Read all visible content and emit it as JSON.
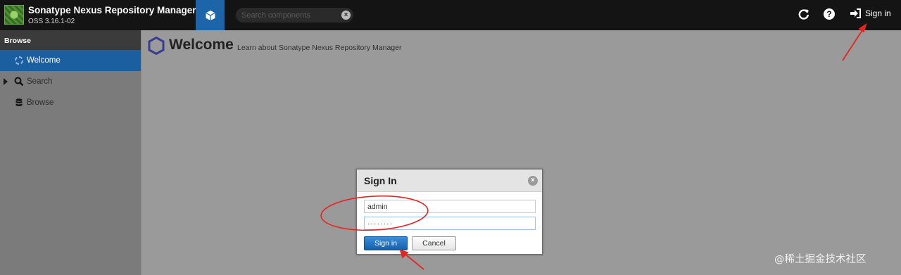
{
  "app": {
    "title": "Sonatype Nexus Repository Manager",
    "version": "OSS 3.16.1-02"
  },
  "header": {
    "browse_mode_icon": "cube-icon",
    "search_placeholder": "Search components",
    "refresh_icon": "refresh-icon",
    "help_icon": "help-icon",
    "help_glyph": "?",
    "signin_label": "Sign in"
  },
  "sidebar": {
    "header": "Browse",
    "items": [
      {
        "label": "Welcome",
        "icon": "spinner-icon",
        "active": true
      },
      {
        "label": "Search",
        "icon": "magnifier-icon"
      },
      {
        "label": "Browse",
        "icon": "database-icon"
      }
    ]
  },
  "main": {
    "title": "Welcome",
    "subtitle": "Learn about Sonatype Nexus Repository Manager"
  },
  "dialog": {
    "title": "Sign In",
    "username_value": "admin",
    "password_value": "········",
    "signin_button": "Sign in",
    "cancel_button": "Cancel"
  },
  "watermark": "@稀土掘金技术社区",
  "colors": {
    "topbar": "#141414",
    "accent": "#1c65a8",
    "annotation": "#e8231f"
  }
}
